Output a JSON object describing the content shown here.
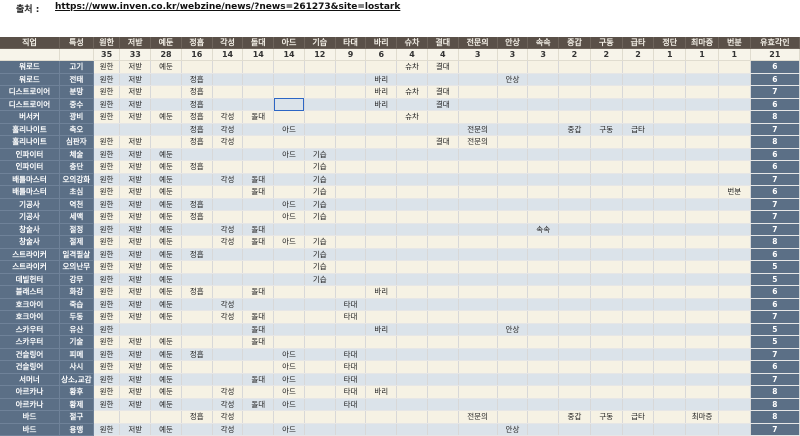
{
  "source": {
    "label": "출처 :",
    "url": "https://www.inven.co.kr/webzine/news/?news=261273&site=lostark"
  },
  "headers": [
    "직업",
    "특성",
    "원한",
    "저받",
    "예둔",
    "정흡",
    "각성",
    "돌대",
    "아드",
    "기습",
    "타대",
    "바리",
    "슈차",
    "결대",
    "전문의",
    "안상",
    "속속",
    "중갑",
    "구동",
    "급타",
    "정단",
    "최마증",
    "번분",
    "유효각인"
  ],
  "counts": [
    "",
    "",
    "35",
    "33",
    "28",
    "16",
    "14",
    "14",
    "14",
    "12",
    "9",
    "6",
    "4",
    "4",
    "3",
    "3",
    "3",
    "2",
    "2",
    "2",
    "1",
    "1",
    "1",
    "21"
  ],
  "rows": [
    [
      "워로드",
      "고기",
      "원한",
      "저받",
      "예둔",
      "",
      "",
      "",
      "",
      "",
      "",
      "",
      "슈차",
      "결대",
      "",
      "",
      "",
      "",
      "",
      "",
      "",
      "",
      "",
      "6"
    ],
    [
      "워로드",
      "전태",
      "원한",
      "저받",
      "",
      "정흡",
      "",
      "",
      "",
      "",
      "",
      "바리",
      "",
      "",
      "",
      "안상",
      "",
      "",
      "",
      "",
      "",
      "",
      "",
      "6"
    ],
    [
      "디스트로이어",
      "분망",
      "원한",
      "저받",
      "",
      "정흡",
      "",
      "",
      "",
      "",
      "",
      "바리",
      "슈차",
      "결대",
      "",
      "",
      "",
      "",
      "",
      "",
      "",
      "",
      "",
      "7"
    ],
    [
      "디스트로이어",
      "중수",
      "원한",
      "저받",
      "",
      "정흡",
      "",
      "",
      "",
      "",
      "",
      "바리",
      "",
      "결대",
      "",
      "",
      "",
      "",
      "",
      "",
      "",
      "",
      "",
      "6"
    ],
    [
      "버서커",
      "광비",
      "원한",
      "저받",
      "예둔",
      "정흡",
      "각성",
      "돌대",
      "",
      "",
      "",
      "",
      "슈차",
      "",
      "",
      "",
      "",
      "",
      "",
      "",
      "",
      "",
      "",
      "8"
    ],
    [
      "홀리나이트",
      "축오",
      "",
      "",
      "",
      "정흡",
      "각성",
      "",
      "아드",
      "",
      "",
      "",
      "",
      "",
      "전문의",
      "",
      "",
      "중갑",
      "구동",
      "급타",
      "",
      "",
      "",
      "7"
    ],
    [
      "홀리나이트",
      "심판자",
      "원한",
      "저받",
      "",
      "정흡",
      "각성",
      "",
      "",
      "",
      "",
      "",
      "",
      "결대",
      "전문의",
      "",
      "",
      "",
      "",
      "",
      "",
      "",
      "",
      "8"
    ],
    [
      "인파이터",
      "체술",
      "원한",
      "저받",
      "예둔",
      "",
      "",
      "",
      "아드",
      "기습",
      "",
      "",
      "",
      "",
      "",
      "",
      "",
      "",
      "",
      "",
      "",
      "",
      "",
      "6"
    ],
    [
      "인파이터",
      "충단",
      "원한",
      "저받",
      "예둔",
      "정흡",
      "",
      "",
      "",
      "기습",
      "",
      "",
      "",
      "",
      "",
      "",
      "",
      "",
      "",
      "",
      "",
      "",
      "",
      "6"
    ],
    [
      "배틀마스터",
      "오의강화",
      "원한",
      "저받",
      "예둔",
      "",
      "각성",
      "돌대",
      "",
      "기습",
      "",
      "",
      "",
      "",
      "",
      "",
      "",
      "",
      "",
      "",
      "",
      "",
      "",
      "7"
    ],
    [
      "배틀마스터",
      "초심",
      "원한",
      "저받",
      "예둔",
      "",
      "",
      "돌대",
      "",
      "기습",
      "",
      "",
      "",
      "",
      "",
      "",
      "",
      "",
      "",
      "",
      "",
      "",
      "번분",
      "6"
    ],
    [
      "기공사",
      "역천",
      "원한",
      "저받",
      "예둔",
      "정흡",
      "",
      "",
      "아드",
      "기습",
      "",
      "",
      "",
      "",
      "",
      "",
      "",
      "",
      "",
      "",
      "",
      "",
      "",
      "7"
    ],
    [
      "기공사",
      "세맥",
      "원한",
      "저받",
      "예둔",
      "정흡",
      "",
      "",
      "아드",
      "기습",
      "",
      "",
      "",
      "",
      "",
      "",
      "",
      "",
      "",
      "",
      "",
      "",
      "",
      "7"
    ],
    [
      "창술사",
      "절정",
      "원한",
      "저받",
      "예둔",
      "",
      "각성",
      "돌대",
      "",
      "",
      "",
      "",
      "",
      "",
      "",
      "",
      "속속",
      "",
      "",
      "",
      "",
      "",
      "",
      "7"
    ],
    [
      "창술사",
      "절제",
      "원한",
      "저받",
      "예둔",
      "",
      "각성",
      "돌대",
      "아드",
      "기습",
      "",
      "",
      "",
      "",
      "",
      "",
      "",
      "",
      "",
      "",
      "",
      "",
      "",
      "8"
    ],
    [
      "스트라이커",
      "일격필살",
      "원한",
      "저받",
      "예둔",
      "정흡",
      "",
      "",
      "",
      "기습",
      "",
      "",
      "",
      "",
      "",
      "",
      "",
      "",
      "",
      "",
      "",
      "",
      "",
      "6"
    ],
    [
      "스트라이커",
      "오의난무",
      "원한",
      "저받",
      "예둔",
      "",
      "",
      "",
      "",
      "기습",
      "",
      "",
      "",
      "",
      "",
      "",
      "",
      "",
      "",
      "",
      "",
      "",
      "",
      "5"
    ],
    [
      "데빌헌터",
      "강무",
      "원한",
      "저받",
      "예둔",
      "",
      "",
      "",
      "",
      "기습",
      "",
      "",
      "",
      "",
      "",
      "",
      "",
      "",
      "",
      "",
      "",
      "",
      "",
      "5"
    ],
    [
      "블래스터",
      "화강",
      "원한",
      "저받",
      "예둔",
      "정흡",
      "",
      "돌대",
      "",
      "",
      "",
      "바리",
      "",
      "",
      "",
      "",
      "",
      "",
      "",
      "",
      "",
      "",
      "",
      "6"
    ],
    [
      "호크아이",
      "죽습",
      "원한",
      "저받",
      "예둔",
      "",
      "각성",
      "",
      "",
      "",
      "타대",
      "",
      "",
      "",
      "",
      "",
      "",
      "",
      "",
      "",
      "",
      "",
      "",
      "6"
    ],
    [
      "호크아이",
      "두동",
      "원한",
      "저받",
      "예둔",
      "",
      "각성",
      "돌대",
      "",
      "",
      "타대",
      "",
      "",
      "",
      "",
      "",
      "",
      "",
      "",
      "",
      "",
      "",
      "",
      "7"
    ],
    [
      "스카우터",
      "유산",
      "원한",
      "",
      "",
      "",
      "",
      "돌대",
      "",
      "",
      "",
      "바리",
      "",
      "",
      "",
      "안상",
      "",
      "",
      "",
      "",
      "",
      "",
      "",
      "5"
    ],
    [
      "스카우터",
      "기술",
      "원한",
      "저받",
      "예둔",
      "",
      "",
      "돌대",
      "",
      "",
      "",
      "",
      "",
      "",
      "",
      "",
      "",
      "",
      "",
      "",
      "",
      "",
      "",
      "5"
    ],
    [
      "건슬링어",
      "피메",
      "원한",
      "저받",
      "예둔",
      "정흡",
      "",
      "",
      "아드",
      "",
      "타대",
      "",
      "",
      "",
      "",
      "",
      "",
      "",
      "",
      "",
      "",
      "",
      "",
      "7"
    ],
    [
      "건슬링어",
      "사시",
      "원한",
      "저받",
      "예둔",
      "",
      "",
      "",
      "아드",
      "",
      "타대",
      "",
      "",
      "",
      "",
      "",
      "",
      "",
      "",
      "",
      "",
      "",
      "",
      "6"
    ],
    [
      "서머너",
      "상소,교감",
      "원한",
      "저받",
      "예둔",
      "",
      "",
      "돌대",
      "아드",
      "",
      "타대",
      "",
      "",
      "",
      "",
      "",
      "",
      "",
      "",
      "",
      "",
      "",
      "",
      "7"
    ],
    [
      "아르카나",
      "황후",
      "원한",
      "저받",
      "예둔",
      "",
      "각성",
      "",
      "아드",
      "",
      "타대",
      "바리",
      "",
      "",
      "",
      "",
      "",
      "",
      "",
      "",
      "",
      "",
      "",
      "8"
    ],
    [
      "아르카나",
      "황제",
      "원한",
      "저받",
      "예둔",
      "",
      "각성",
      "돌대",
      "아드",
      "",
      "타대",
      "",
      "",
      "",
      "",
      "",
      "",
      "",
      "",
      "",
      "",
      "",
      "",
      "8"
    ],
    [
      "바드",
      "절구",
      "",
      "",
      "",
      "정흡",
      "각성",
      "",
      "",
      "",
      "",
      "",
      "",
      "",
      "전문의",
      "",
      "",
      "중갑",
      "구동",
      "급타",
      "",
      "최마증",
      "",
      "8"
    ],
    [
      "바드",
      "용맹",
      "원한",
      "저받",
      "예둔",
      "",
      "각성",
      "",
      "아드",
      "",
      "",
      "",
      "",
      "",
      "",
      "안상",
      "",
      "",
      "",
      "",
      "",
      "",
      "",
      "7"
    ]
  ]
}
